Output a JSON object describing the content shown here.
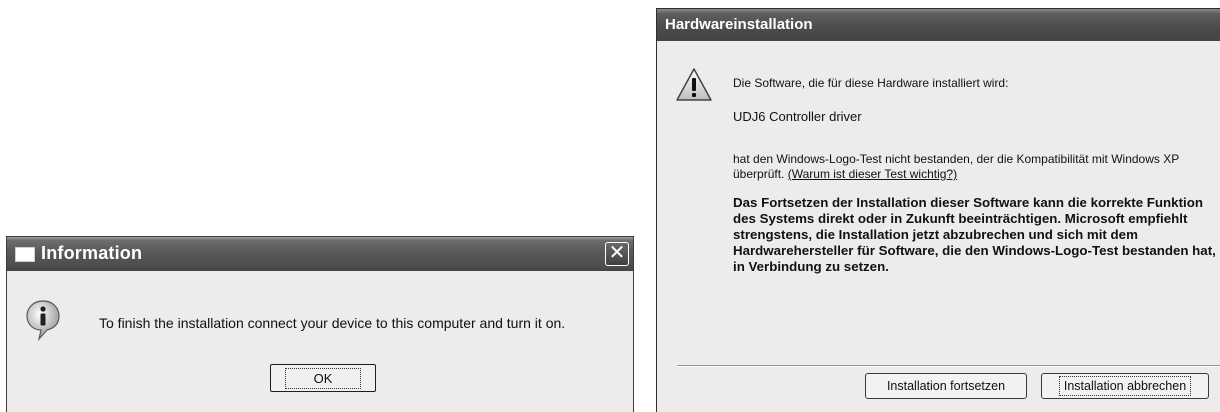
{
  "info_dialog": {
    "title": "Information",
    "close_glyph": "✕",
    "message": "To finish the installation connect your device to this computer and turn it on.",
    "ok_label": "OK",
    "icons": {
      "title": "window-icon",
      "body": "information-icon",
      "close": "close-icon"
    }
  },
  "hw_dialog": {
    "title": "Hardwareinstallation",
    "line1": "Die Software, die für diese Hardware installiert wird:",
    "driver": "UDJ6 Controller driver",
    "logo_text": "hat den Windows-Logo-Test nicht bestanden, der die Kompatibilität mit Windows XP überprüft.",
    "link": "(Warum ist dieser Test wichtig?)",
    "warning": "Das Fortsetzen der Installation dieser Software kann die korrekte Funktion des Systems direkt oder in Zukunft beeinträchtigen. Microsoft empfiehlt strengstens, die Installation jetzt abzubrechen und sich mit dem Hardwarehersteller für Software, die den Windows-Logo-Test bestanden hat, in Verbindung zu setzen.",
    "continue_label": "Installation fortsetzen",
    "cancel_label": "Installation abbrechen",
    "icons": {
      "body": "warning-icon"
    }
  },
  "colors": {
    "titlebar": "#4d4d4d",
    "dialog_bg": "#ececec",
    "text": "#111111"
  }
}
